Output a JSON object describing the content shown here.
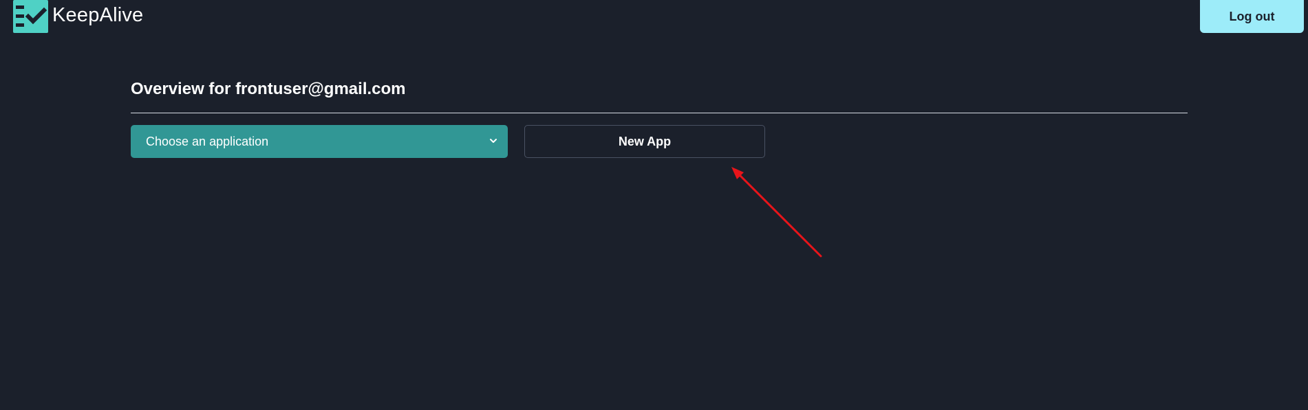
{
  "header": {
    "brand_name": "KeepAlive",
    "logo_icon": "checklist-icon",
    "logout_label": "Log out"
  },
  "main": {
    "title": "Overview for frontuser@gmail.com",
    "app_select": {
      "selected_label": "Choose an application",
      "icon": "chevron-down-icon"
    },
    "new_app_label": "New App"
  },
  "annotation": {
    "icon": "arrow-icon",
    "color": "#e8141a"
  },
  "colors": {
    "background": "#1b202b",
    "logo_teal": "#4fd1c5",
    "select_teal": "#319795",
    "logout_cyan": "#9decf9"
  }
}
